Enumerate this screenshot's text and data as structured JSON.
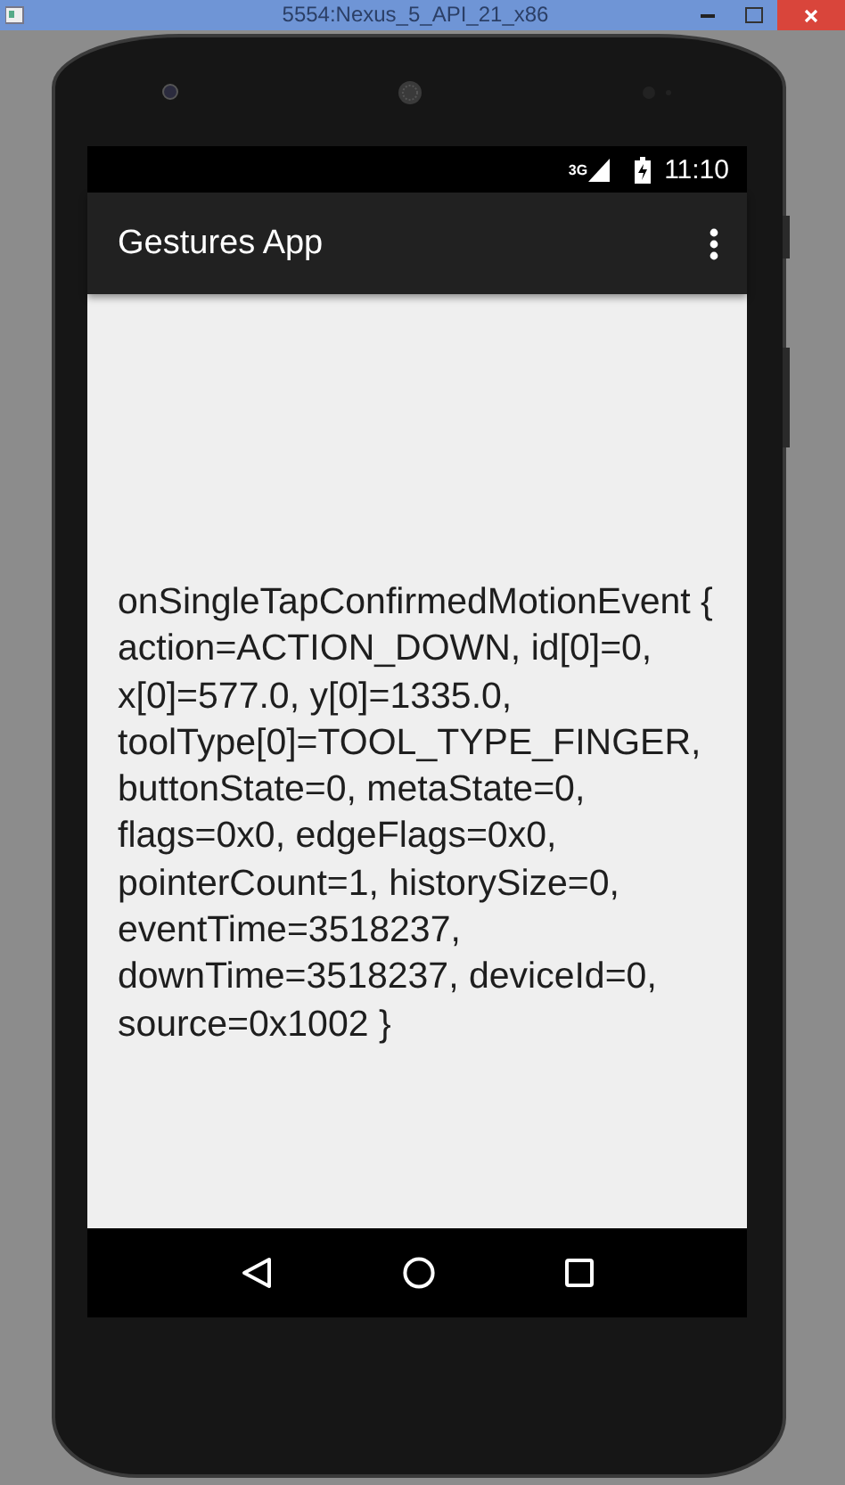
{
  "window": {
    "title": "5554:Nexus_5_API_21_x86",
    "buttons": [
      {
        "kind": "minimize"
      },
      {
        "kind": "maximize"
      },
      {
        "kind": "close"
      }
    ]
  },
  "status_bar": {
    "network": "3G",
    "time": "11:10"
  },
  "app_bar": {
    "title": "Gestures App"
  },
  "content": {
    "text": "onSingleTapConfirmedMotionEvent { action=ACTION_DOWN, id[0]=0, x[0]=577.0, y[0]=1335.0, toolType[0]=TOOL_TYPE_FINGER, buttonState=0, metaState=0, flags=0x0, edgeFlags=0x0, pointerCount=1, historySize=0, eventTime=3518237, downTime=3518237, deviceId=0, source=0x1002 }"
  },
  "nav_bar": {
    "buttons": [
      {
        "kind": "back"
      },
      {
        "kind": "home"
      },
      {
        "kind": "recents"
      }
    ]
  }
}
